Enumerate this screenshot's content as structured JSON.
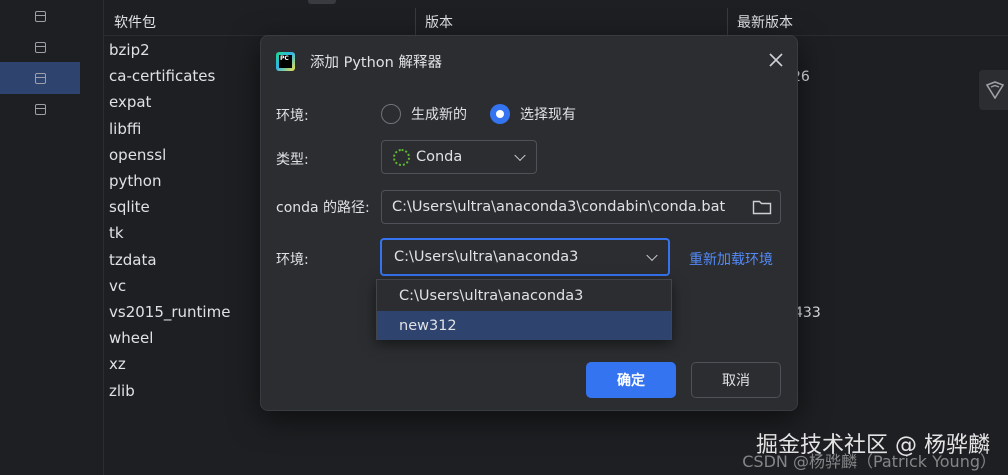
{
  "sidebar": {
    "active_index": 2
  },
  "package_table": {
    "columns": [
      "软件包",
      "版本",
      "最新版本"
    ],
    "packages": [
      "bzip2",
      "ca-certificates",
      "expat",
      "libffi",
      "openssl",
      "python",
      "sqlite",
      "tk",
      "tzdata",
      "vc",
      "vs2015_runtime",
      "wheel",
      "xz",
      "zlib"
    ],
    "latest_fragments": {
      "ca-certificates": "26",
      "vs2015_runtime": "433"
    }
  },
  "dialog": {
    "title": "添加 Python 解释器",
    "env_label": "环境:",
    "env_option_new": "生成新的",
    "env_option_existing": "选择现有",
    "type_label": "类型:",
    "type_value": "Conda",
    "conda_path_label": "conda 的路径:",
    "conda_path_value": "C:\\Users\\ultra\\anaconda3\\condabin\\conda.bat",
    "env_select_label": "环境:",
    "env_select_value": "C:\\Users\\ultra\\anaconda3",
    "reload_link": "重新加载环境",
    "env_options": [
      "C:\\Users\\ultra\\anaconda3",
      "new312"
    ],
    "ok_button": "确定",
    "cancel_button": "取消"
  },
  "watermark": {
    "line1": "掘金技术社区 @ 杨骅麟",
    "line2": "CSDN @杨骅麟（Patrick Young）"
  },
  "colors": {
    "accent": "#3574f0",
    "link": "#548af7",
    "selection": "#2e436e",
    "dialog_bg": "#2b2d30",
    "app_bg": "#1e1f22"
  },
  "icons": [
    "database-icon",
    "pycharm-logo-icon",
    "close-icon",
    "spinner-icon",
    "chevron-down-icon",
    "folder-icon",
    "shield-icon"
  ]
}
